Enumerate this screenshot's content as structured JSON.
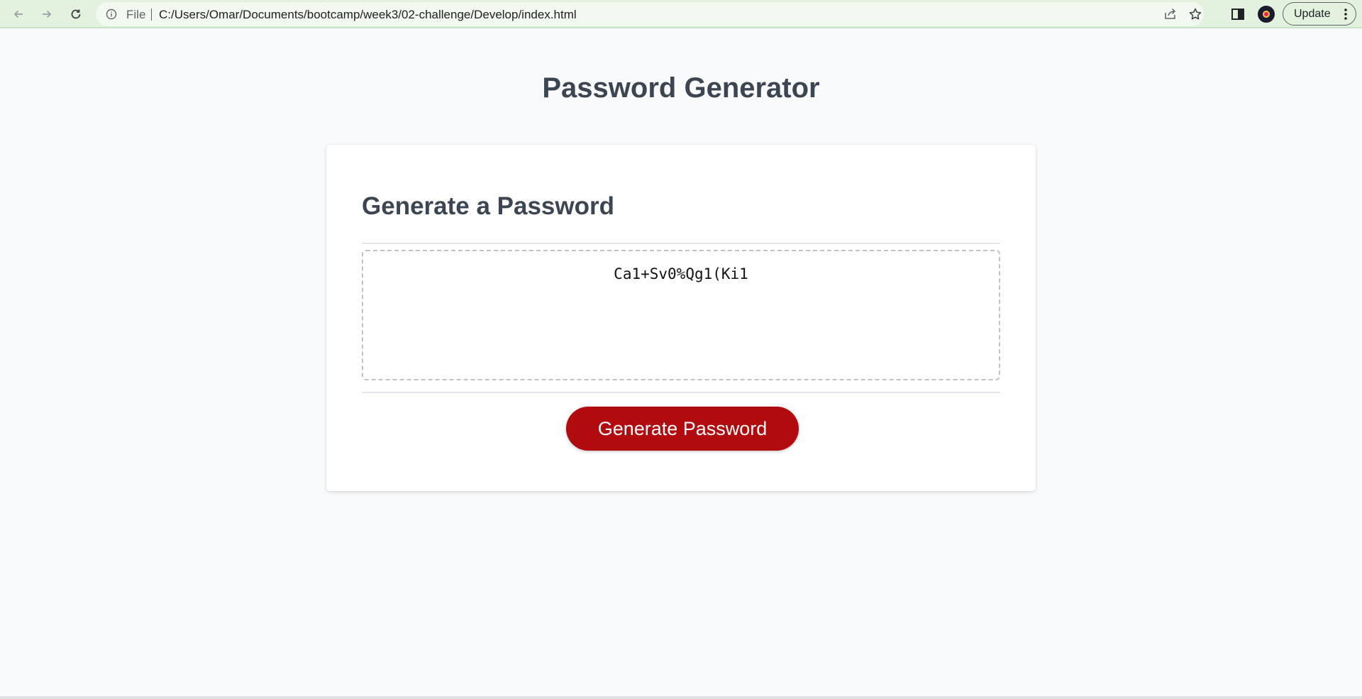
{
  "browser": {
    "address": {
      "scheme_label": "File",
      "url": "C:/Users/Omar/Documents/bootcamp/week3/02-challenge/Develop/index.html"
    },
    "update_label": "Update",
    "colors": {
      "toolbar": "#e3f2df",
      "omnibox": "#f3f9f1"
    }
  },
  "page": {
    "title": "Password Generator",
    "card": {
      "title": "Generate a Password",
      "password_value": "Ca1+Sv0%Qg1(Ki1",
      "button_label": "Generate Password"
    },
    "colors": {
      "button": "#b10a0f",
      "heading": "#3b4652",
      "background": "#f9fafb"
    }
  }
}
